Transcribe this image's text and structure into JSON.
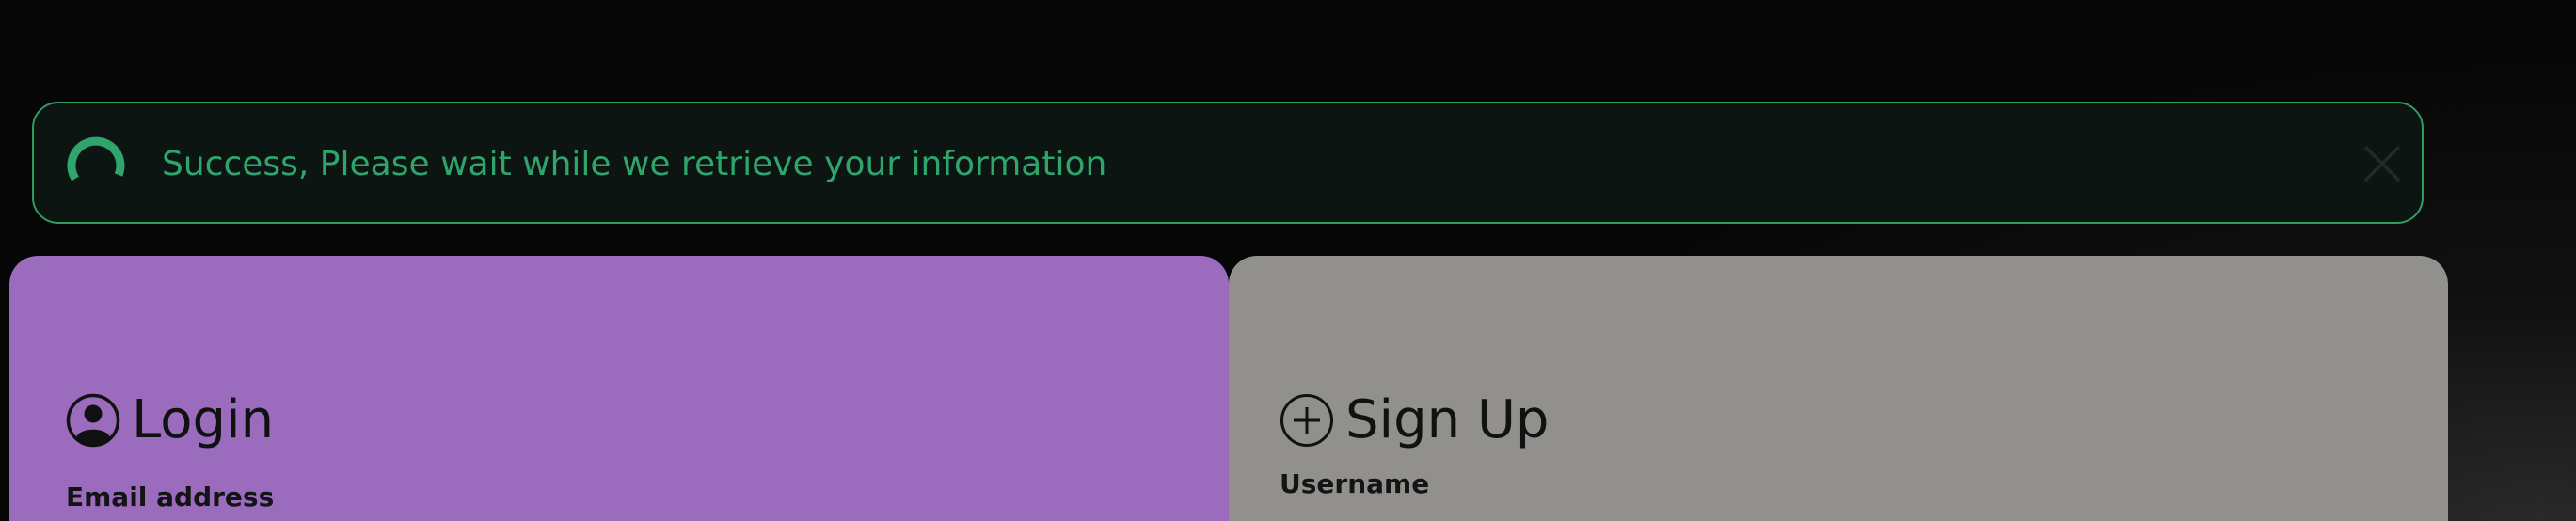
{
  "toast": {
    "message": "Success, Please wait while we retrieve your information",
    "spinner_icon": "spinner-icon",
    "close_icon": "close-icon",
    "accent_color": "#2fa56c",
    "background_color": "#0c1512"
  },
  "login": {
    "heading": "Login",
    "heading_icon": "user-circle-icon",
    "email_label": "Email address",
    "background_color": "#9b6cbd"
  },
  "signup": {
    "heading": "Sign Up",
    "heading_icon": "plus-circle-icon",
    "username_label": "Username",
    "background_color": "#91908d"
  }
}
